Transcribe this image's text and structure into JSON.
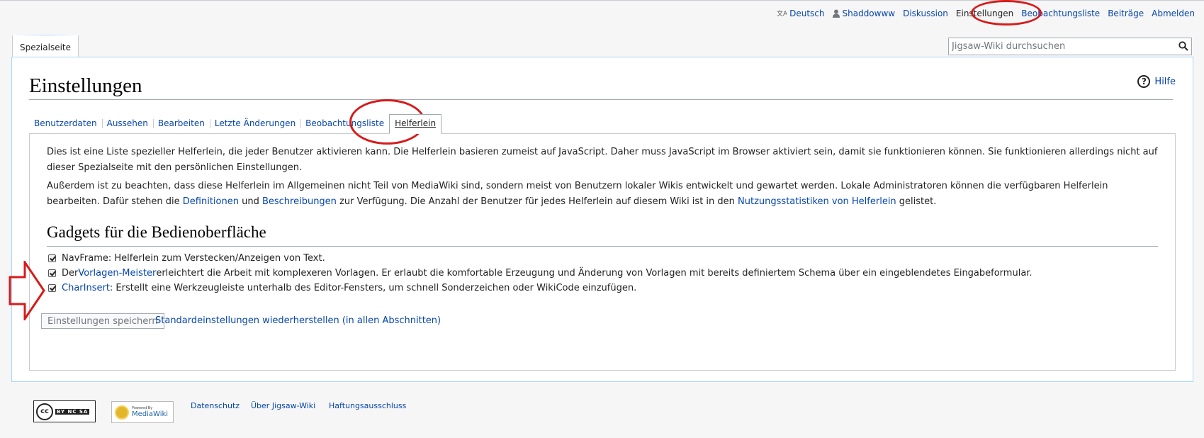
{
  "personal_tools": {
    "language": "Deutsch",
    "user": "Shaddowww",
    "talk": "Diskussion",
    "preferences": "Einstellungen",
    "watchlist": "Beobachtungsliste",
    "contributions": "Beiträge",
    "logout": "Abmelden"
  },
  "namespace_tab": "Spezialseite",
  "search": {
    "placeholder": "Jigsaw-Wiki durchsuchen"
  },
  "page": {
    "title": "Einstellungen",
    "help": "Hilfe"
  },
  "pref_tabs": [
    {
      "label": "Benutzerdaten"
    },
    {
      "label": "Aussehen"
    },
    {
      "label": "Bearbeiten"
    },
    {
      "label": "Letzte Änderungen"
    },
    {
      "label": "Beobachtungsliste"
    },
    {
      "label": "Helferlein",
      "selected": true
    }
  ],
  "intro": {
    "p1": "Dies ist eine Liste spezieller Helferlein, die jeder Benutzer aktivieren kann. Die Helferlein basieren zumeist auf JavaScript. Daher muss JavaScript im Browser aktiviert sein, damit sie funktionieren können. Sie funktionieren allerdings nicht auf dieser Spezialseite mit den persönlichen Einstellungen.",
    "p2_a": "Außerdem ist zu beachten, dass diese Helferlein im Allgemeinen nicht Teil von MediaWiki sind, sondern meist von Benutzern lokaler Wikis entwickelt und gewartet werden. Lokale Administratoren können die verfügbaren Helferlein bearbeiten. Dafür stehen die ",
    "p2_link1": "Definitionen",
    "p2_b": " und ",
    "p2_link2": "Beschreibungen",
    "p2_c": " zur Verfügung. Die Anzahl der Benutzer für jedes Helferlein auf diesem Wiki ist in den ",
    "p2_link3": "Nutzungsstatistiken von Helferlein",
    "p2_d": " gelistet."
  },
  "section": {
    "heading": "Gadgets für die Bedienoberfläche"
  },
  "gadgets": [
    {
      "checked": true,
      "pre": "",
      "link": "",
      "text": "NavFrame: Helferlein zum Verstecken/Anzeigen von Text."
    },
    {
      "checked": true,
      "pre": "Der ",
      "link": "Vorlagen-Meister",
      "text": " erleichtert die Arbeit mit komplexeren Vorlagen. Er erlaubt die komfortable Erzeugung und Änderung von Vorlagen mit bereits definiertem Schema über ein eingeblendetes Eingabeformular."
    },
    {
      "checked": true,
      "pre": "",
      "link": "CharInsert",
      "text": ": Erstellt eine Werkzeugleiste unterhalb des Editor-Fensters, um schnell Sonderzeichen oder WikiCode einzufügen."
    }
  ],
  "actions": {
    "save": "Einstellungen speichern",
    "reset": "Standardeinstellungen wiederherstellen (in allen Abschnitten)"
  },
  "footer": {
    "cc_label": "cc",
    "cc_tags": "BY NC SA",
    "mw_powered": "Powered By",
    "mw_name": "MediaWiki",
    "links": [
      "Datenschutz",
      "Über Jigsaw-Wiki",
      "Haftungsausschluss"
    ]
  },
  "colors": {
    "link": "#0645ad",
    "annotation": "#d61b1b",
    "border": "#a7d7f9"
  }
}
